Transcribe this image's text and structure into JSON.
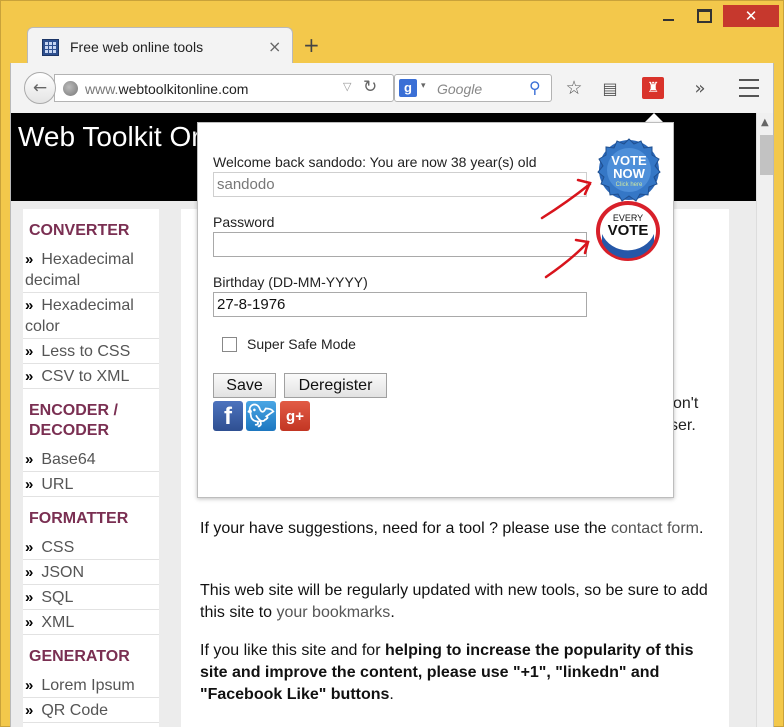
{
  "browser": {
    "tab_title": "Free web online tools",
    "tab_close": "×",
    "new_tab": "+",
    "url_dim": "www.",
    "url_host": "webtoolkitonline.com",
    "search_engine_letter": "g",
    "search_placeholder": "Google"
  },
  "site": {
    "title": "Web Toolkit Or"
  },
  "sidebar": {
    "sections": [
      {
        "heading": "CONVERTER",
        "items": [
          "Hexadecimal decimal",
          "Hexadecimal color",
          "Less to CSS",
          "CSV to XML"
        ]
      },
      {
        "heading": "ENCODER / DECODER",
        "items": [
          "Base64",
          "URL"
        ]
      },
      {
        "heading": "FORMATTER",
        "items": [
          "CSS",
          "JSON",
          "SQL",
          "XML"
        ]
      },
      {
        "heading": "GENERATOR",
        "items": [
          "Lorem Ipsum",
          "QR Code"
        ]
      }
    ]
  },
  "main": {
    "partial_line1": "on't",
    "partial_line2": "ser.",
    "p1_text": "If your have suggestions, need for a tool ? please use the",
    "p1_link": "contact form",
    "p1_end": ".",
    "p2_text": "This web site will be regularly updated with new tools, so be sure to add this site to",
    "p2_link": "your bookmarks",
    "p2_end": ".",
    "p3_text": "If you like this site and for",
    "p3_bold": "helping to increase the popularity of this site and improve the content, please use \"+1\", \"linkedn\" and \"Facebook Like\" buttons",
    "p3_end": "."
  },
  "popup": {
    "welcome": "Welcome back sandodo: You are now 38 year(s) old",
    "username_value": "sandodo",
    "password_label": "Password",
    "password_value": "",
    "birthday_label": "Birthday (DD-MM-YYYY)",
    "birthday_value": "27-8-1976",
    "safe_mode_label": "Super Safe Mode",
    "safe_mode_checked": false,
    "save_label": "Save",
    "deregister_label": "Deregister"
  },
  "badges": {
    "vote_now_line1": "VOTE",
    "vote_now_line2": "NOW",
    "vote_now_line3": "Click here",
    "every_line1": "EVERY",
    "every_line2": "VOTE",
    "every_line3": "COUNTS"
  },
  "colors": {
    "window_frame": "#f3c84b",
    "close_button": "#c6382d",
    "sidebar_heading": "#7a2f52",
    "annotation_arrow": "#d8141c"
  }
}
